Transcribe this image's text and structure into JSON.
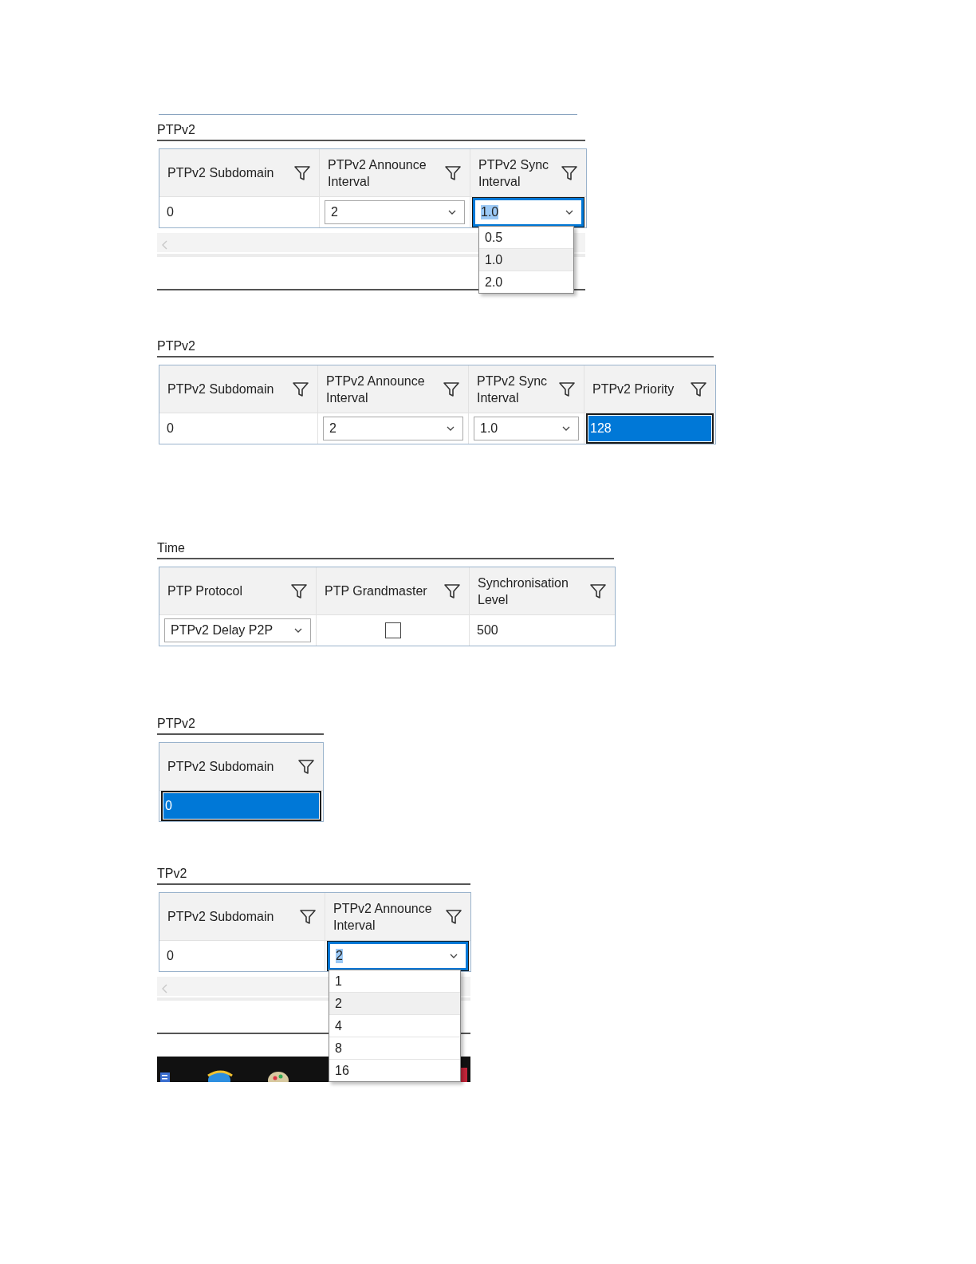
{
  "panels": [
    {
      "title": "PTPv2",
      "top_rule": true,
      "scrollbar": true,
      "columns": [
        "PTPv2 Subdomain",
        "PTPv2 Announce Interval",
        "PTPv2 Sync Interval"
      ],
      "cells": [
        {
          "kind": "text",
          "value": "0",
          "selected": false
        },
        {
          "kind": "dropdown",
          "value": "2",
          "selected": false
        },
        {
          "kind": "dropdown",
          "value": "1.0",
          "selected": true,
          "open": true,
          "options": [
            {
              "label": "0.5",
              "selected": false
            },
            {
              "label": "1.0",
              "selected": true
            },
            {
              "label": "2.0",
              "selected": false
            }
          ]
        }
      ]
    },
    {
      "title": "PTPv2",
      "columns": [
        "PTPv2 Subdomain",
        "PTPv2 Announce Interval",
        "PTPv2 Sync Interval",
        "PTPv2 Priority"
      ],
      "cells": [
        {
          "kind": "text",
          "value": "0",
          "selected": false
        },
        {
          "kind": "dropdown",
          "value": "2",
          "selected": false
        },
        {
          "kind": "dropdown",
          "value": "1.0",
          "selected": false
        },
        {
          "kind": "text",
          "value": "128",
          "selected": true
        }
      ]
    },
    {
      "title": "Time",
      "columns": [
        "PTP Protocol",
        "PTP Grandmaster",
        "Synchronisation Level"
      ],
      "cells": [
        {
          "kind": "dropdown",
          "value": "PTPv2 Delay P2P",
          "selected": false
        },
        {
          "kind": "checkbox",
          "checked": false
        },
        {
          "kind": "text",
          "value": "500",
          "selected": false
        }
      ]
    },
    {
      "title": "PTPv2",
      "columns": [
        "PTPv2 Subdomain"
      ],
      "cells": [
        {
          "kind": "text",
          "value": "0",
          "selected": true
        }
      ]
    },
    {
      "title": "TPv2",
      "scrollbar": true,
      "taskbar": true,
      "columns": [
        "PTPv2 Subdomain",
        "PTPv2 Announce Interval"
      ],
      "cells": [
        {
          "kind": "text",
          "value": "0",
          "selected": false
        },
        {
          "kind": "dropdown",
          "value": "2",
          "selected": true,
          "open": true,
          "options": [
            {
              "label": "1",
              "selected": false
            },
            {
              "label": "2",
              "selected": true
            },
            {
              "label": "4",
              "selected": false
            },
            {
              "label": "8",
              "selected": false
            },
            {
              "label": "16",
              "selected": false
            }
          ]
        }
      ]
    }
  ]
}
